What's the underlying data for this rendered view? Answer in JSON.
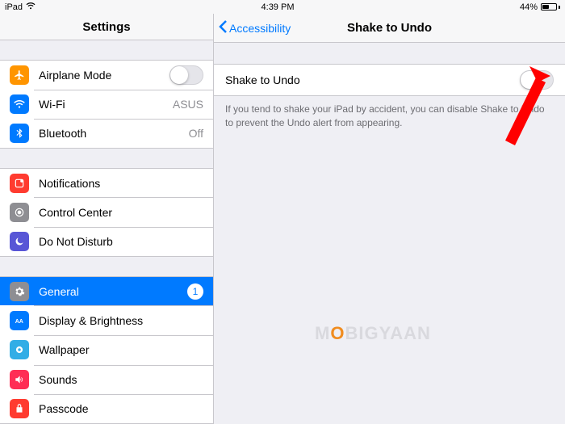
{
  "statusbar": {
    "device": "iPad",
    "time": "4:39 PM",
    "battery_pct": "44%"
  },
  "left_title": "Settings",
  "back_label": "Accessibility",
  "right_title": "Shake to Undo",
  "detail": {
    "row_label": "Shake to Undo",
    "helper": "If you tend to shake your iPad by accident, you can disable Shake to Undo to prevent the Undo alert from appearing."
  },
  "rows": {
    "airplane": "Airplane Mode",
    "wifi": "Wi-Fi",
    "wifi_value": "ASUS",
    "bluetooth": "Bluetooth",
    "bluetooth_value": "Off",
    "notifications": "Notifications",
    "control_center": "Control Center",
    "dnd": "Do Not Disturb",
    "general": "General",
    "general_badge": "1",
    "display": "Display & Brightness",
    "wallpaper": "Wallpaper",
    "sounds": "Sounds",
    "passcode": "Passcode"
  },
  "watermark": {
    "a": "M",
    "b": "O",
    "c": "BIGYAAN"
  }
}
